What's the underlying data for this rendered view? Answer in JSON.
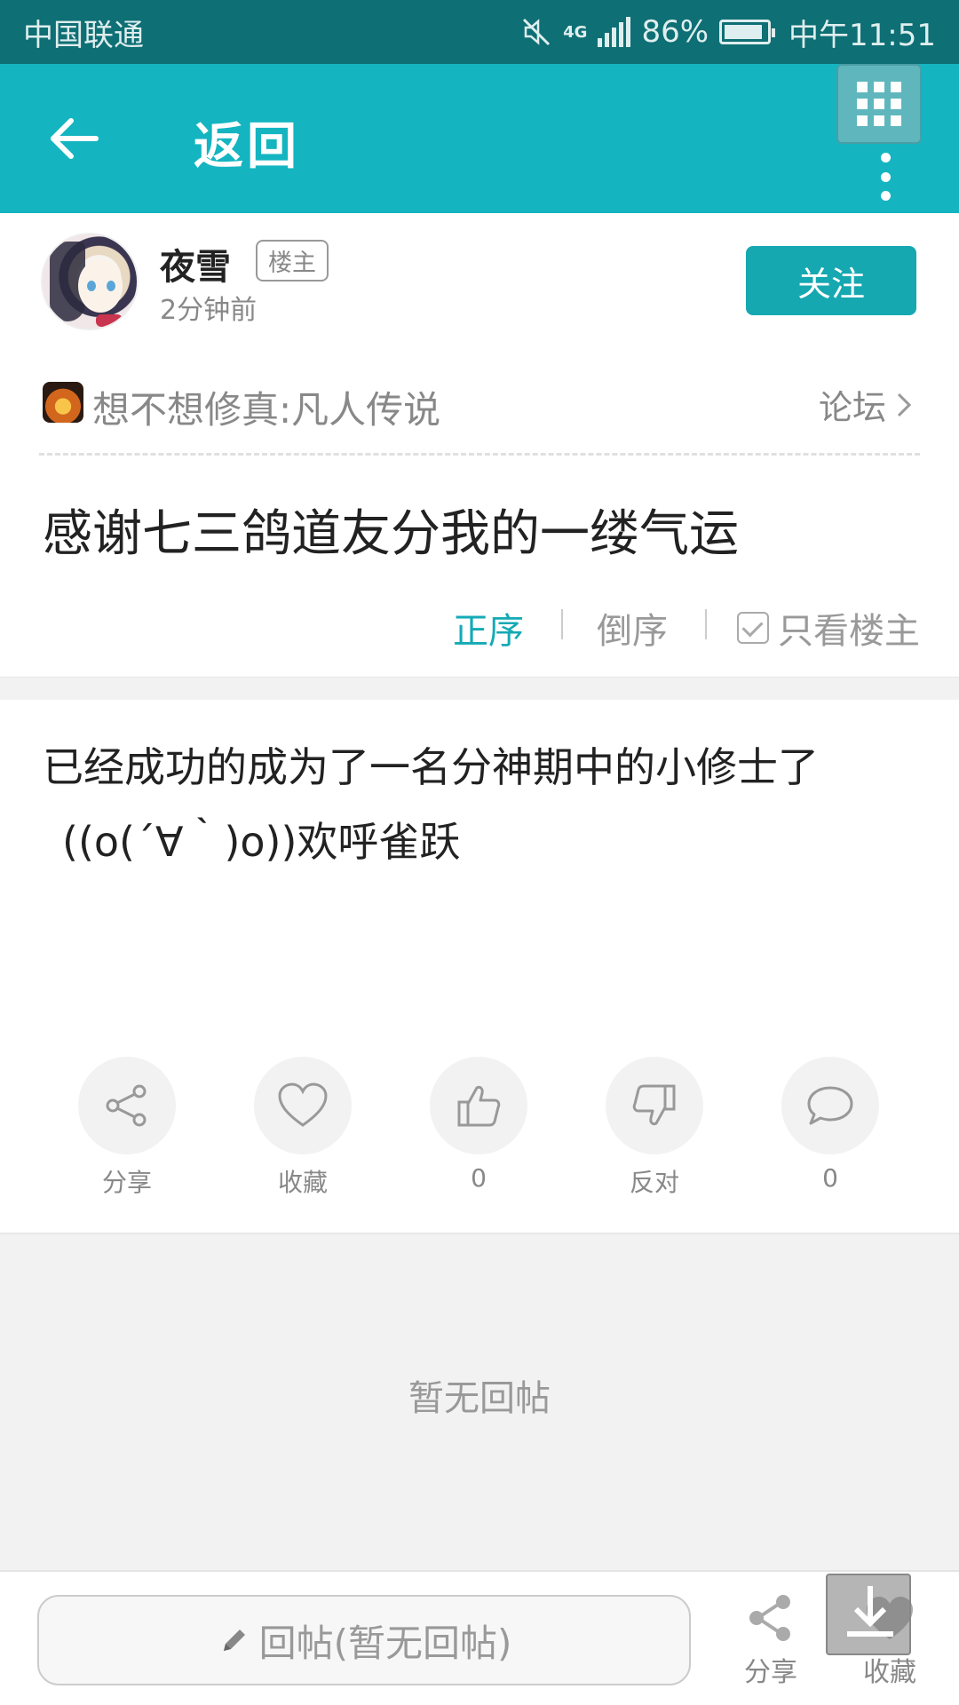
{
  "status_bar": {
    "carrier": "中国联通",
    "network": "4G",
    "battery": "86%",
    "time": "中午11:51"
  },
  "header": {
    "back_label": "返回"
  },
  "author": {
    "name": "夜雪",
    "badge": "楼主",
    "time": "2分钟前",
    "follow_label": "关注"
  },
  "game": {
    "name": "想不想修真:凡人传说",
    "forum_label": "论坛"
  },
  "post": {
    "title": "感谢七三鸽道友分我的一缕气运",
    "content_line1": "已经成功的成为了一名分神期中的小修士了",
    "content_line2": "((o(´∀｀)o))欢呼雀跃"
  },
  "sort": {
    "asc": "正序",
    "desc": "倒序",
    "op_only": "只看楼主"
  },
  "actions": [
    {
      "label": "分享",
      "icon": "share-icon"
    },
    {
      "label": "收藏",
      "icon": "heart-icon"
    },
    {
      "label": "0",
      "icon": "thumbs-up-icon"
    },
    {
      "label": "反对",
      "icon": "thumbs-down-icon"
    },
    {
      "label": "0",
      "icon": "comment-icon"
    }
  ],
  "replies": {
    "empty_text": "暂无回帖"
  },
  "bottom_bar": {
    "reply_placeholder": "回帖(暂无回帖)",
    "share_label": "分享",
    "fav_label": "收藏"
  },
  "colors": {
    "status_bar": "#0e6f75",
    "header": "#14b5c1",
    "accent": "#15a8b1"
  }
}
